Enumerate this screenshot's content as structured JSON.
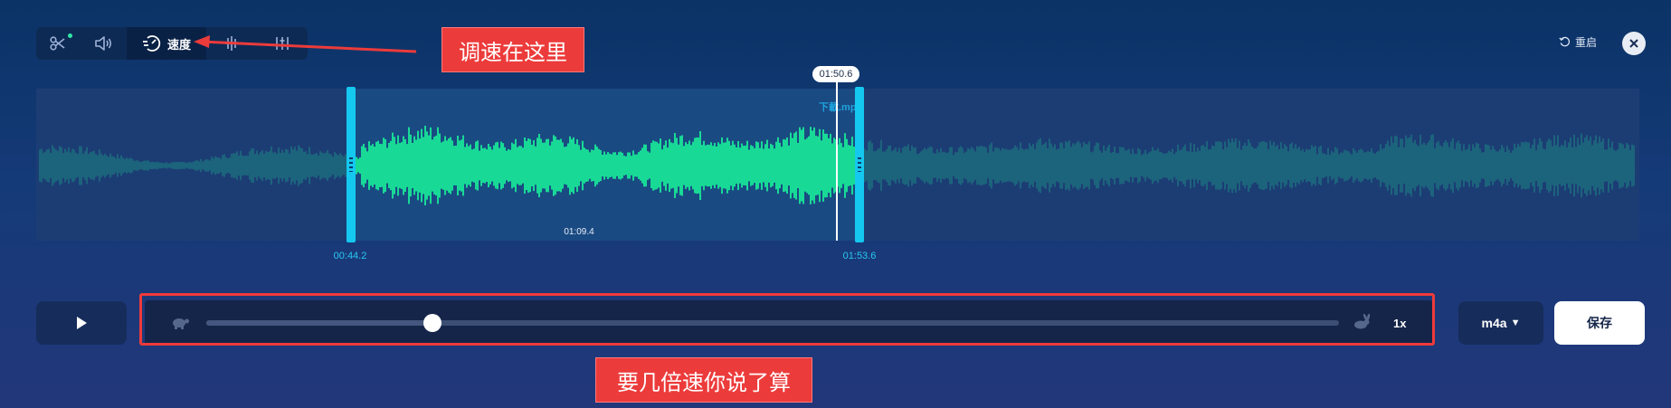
{
  "toolbar": {
    "tools": [
      {
        "icon": "scissors-icon"
      },
      {
        "icon": "volume-icon"
      },
      {
        "icon": "speed-icon",
        "label": "速度",
        "active": true
      },
      {
        "icon": "equalizer-icon"
      },
      {
        "icon": "mixer-icon"
      }
    ],
    "restart_label": "重启",
    "close_icon": "close-icon"
  },
  "waveform": {
    "filename": "下載.mp",
    "playhead_time": "01:50.6",
    "selection_duration": "01:09.4",
    "start_time": "00:44.2",
    "end_time": "01:53.6",
    "colors": {
      "selected": "#19ff9c",
      "unselected": "#1d6d7f",
      "handle": "#14c8f0"
    }
  },
  "controls": {
    "play_icon": "play-icon",
    "slow_icon": "turtle-icon",
    "fast_icon": "rabbit-icon",
    "speed_value": "1x",
    "speed_slider_position": 0.2,
    "format_label": "m4a",
    "format_caret": "▼",
    "save_label": "保存"
  },
  "annotations": {
    "speed_tip": "调速在这里",
    "slider_tip": "要几倍速你说了算",
    "color": "#ec3b3b"
  }
}
